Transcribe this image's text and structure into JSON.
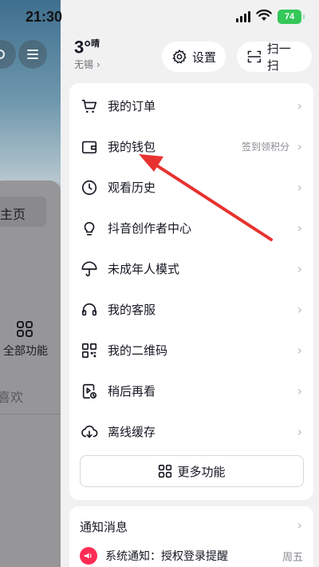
{
  "status_bar": {
    "time": "21:30",
    "battery": "74"
  },
  "background_app": {
    "home_label": "主页",
    "all_functions": "全部功能",
    "favorites_partial": "喜欢"
  },
  "weather": {
    "temperature": "3°",
    "condition": "晴",
    "city": "无锡"
  },
  "header": {
    "settings_label": "设置",
    "scan_label": "扫一扫"
  },
  "menu": {
    "items": [
      {
        "label": "我的订单",
        "hint": "",
        "icon": "cart-icon"
      },
      {
        "label": "我的钱包",
        "hint": "签到领积分",
        "icon": "wallet-icon"
      },
      {
        "label": "观看历史",
        "hint": "",
        "icon": "history-clock-icon"
      },
      {
        "label": "抖音创作者中心",
        "hint": "",
        "icon": "lightbulb-icon"
      },
      {
        "label": "未成年人模式",
        "hint": "",
        "icon": "umbrella-icon"
      },
      {
        "label": "我的客服",
        "hint": "",
        "icon": "headset-icon"
      },
      {
        "label": "我的二维码",
        "hint": "",
        "icon": "qrcode-icon"
      },
      {
        "label": "稍后再看",
        "hint": "",
        "icon": "watch-later-icon"
      },
      {
        "label": "离线缓存",
        "hint": "",
        "icon": "cloud-download-icon"
      }
    ],
    "more_label": "更多功能"
  },
  "notice": {
    "title": "通知消息",
    "message": "系统通知：授权登录提醒",
    "day": "周五"
  },
  "colors": {
    "accent_red": "#fe2c55",
    "arrow_red": "#e8322f",
    "battery_green": "#34c759"
  }
}
